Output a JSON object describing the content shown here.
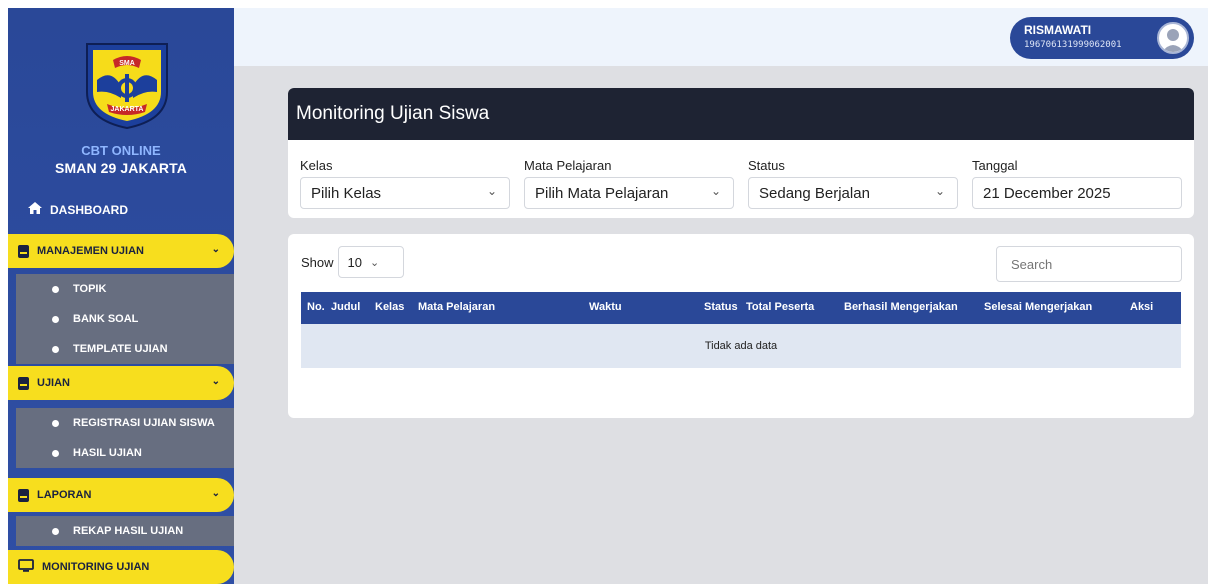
{
  "sidebar": {
    "school_top": "CBT ONLINE",
    "school_name": "SMAN 29 JAKARTA",
    "logo_text_top": "SMA",
    "logo_text_bottom": "JAKARTA",
    "dashboard": "DASHBOARD",
    "menus": [
      {
        "label": "MANAJEMEN UJIAN",
        "items": [
          "TOPIK",
          "BANK SOAL",
          "TEMPLATE UJIAN"
        ]
      },
      {
        "label": "UJIAN",
        "items": [
          "REGISTRASI UJIAN SISWA",
          "HASIL UJIAN"
        ]
      },
      {
        "label": "LAPORAN",
        "items": [
          "REKAP HASIL UJIAN"
        ]
      }
    ],
    "monitoring": "MONITORING UJIAN"
  },
  "user": {
    "name": "RISMAWATI",
    "nip": "196706131999062001"
  },
  "monitor": {
    "title": "Monitoring Ujian Siswa",
    "filters": [
      {
        "label": "Kelas",
        "value": "Pilih Kelas"
      },
      {
        "label": "Mata Pelajaran",
        "value": "Pilih Mata Pelajaran"
      },
      {
        "label": "Status",
        "value": "Sedang Berjalan"
      },
      {
        "label": "Tanggal",
        "value": "21 December 2025"
      }
    ]
  },
  "table": {
    "show_label": "Show",
    "page_size": "10",
    "search_placeholder": "Search",
    "columns": [
      "No.",
      "Judul",
      "Kelas",
      "Mata Pelajaran",
      "Waktu",
      "Status",
      "Total Peserta",
      "Berhasil Mengerjakan",
      "Selesai Mengerjakan",
      "Aksi"
    ],
    "empty": "Tidak ada data"
  },
  "colors": {
    "sidebar": "#2a4898",
    "menu_yellow": "#f7de1e",
    "header_dark": "#1e2333",
    "table_head": "#2a4898"
  }
}
